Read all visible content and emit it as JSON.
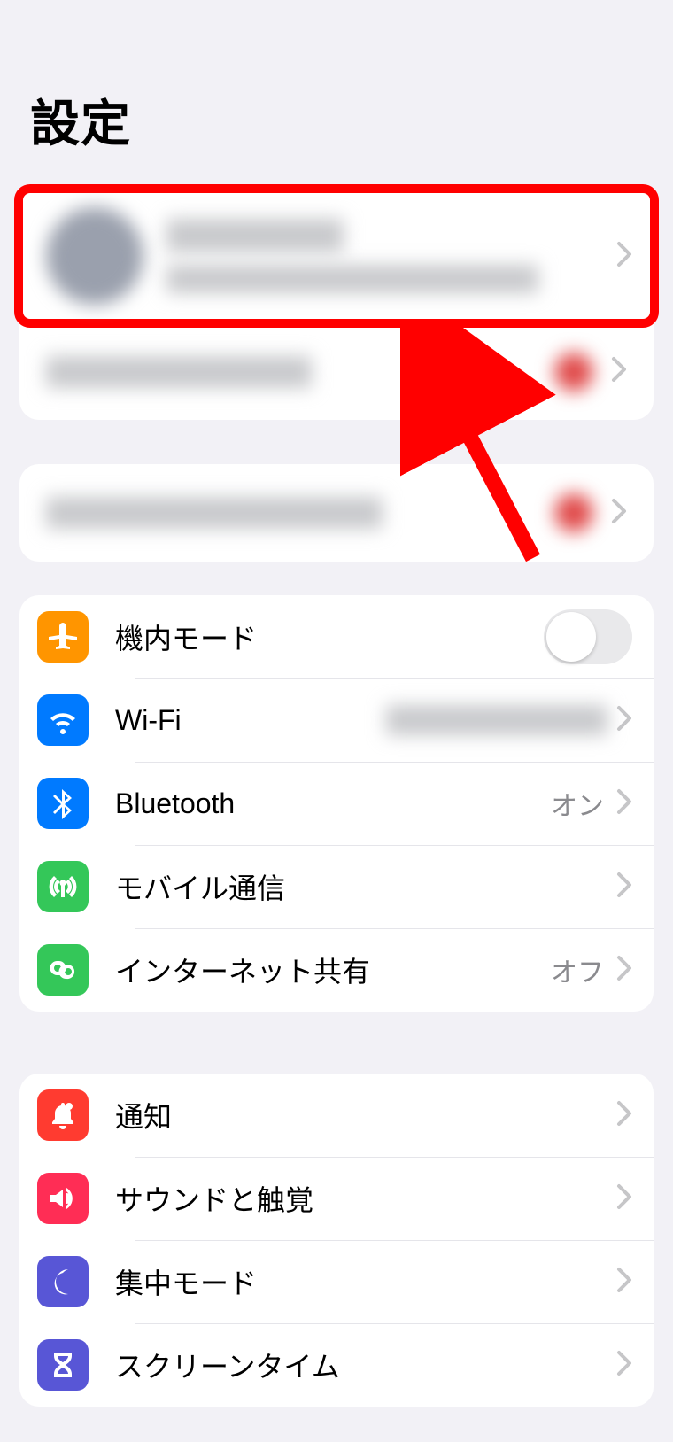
{
  "title": "設定",
  "connectivity": {
    "airplane": {
      "label": "機内モード",
      "on": false
    },
    "wifi": {
      "label": "Wi-Fi"
    },
    "bluetooth": {
      "label": "Bluetooth",
      "value": "オン"
    },
    "cellular": {
      "label": "モバイル通信"
    },
    "hotspot": {
      "label": "インターネット共有",
      "value": "オフ"
    }
  },
  "system": {
    "notifications": {
      "label": "通知"
    },
    "sounds": {
      "label": "サウンドと触覚"
    },
    "focus": {
      "label": "集中モード"
    },
    "screentime": {
      "label": "スクリーンタイム"
    }
  }
}
